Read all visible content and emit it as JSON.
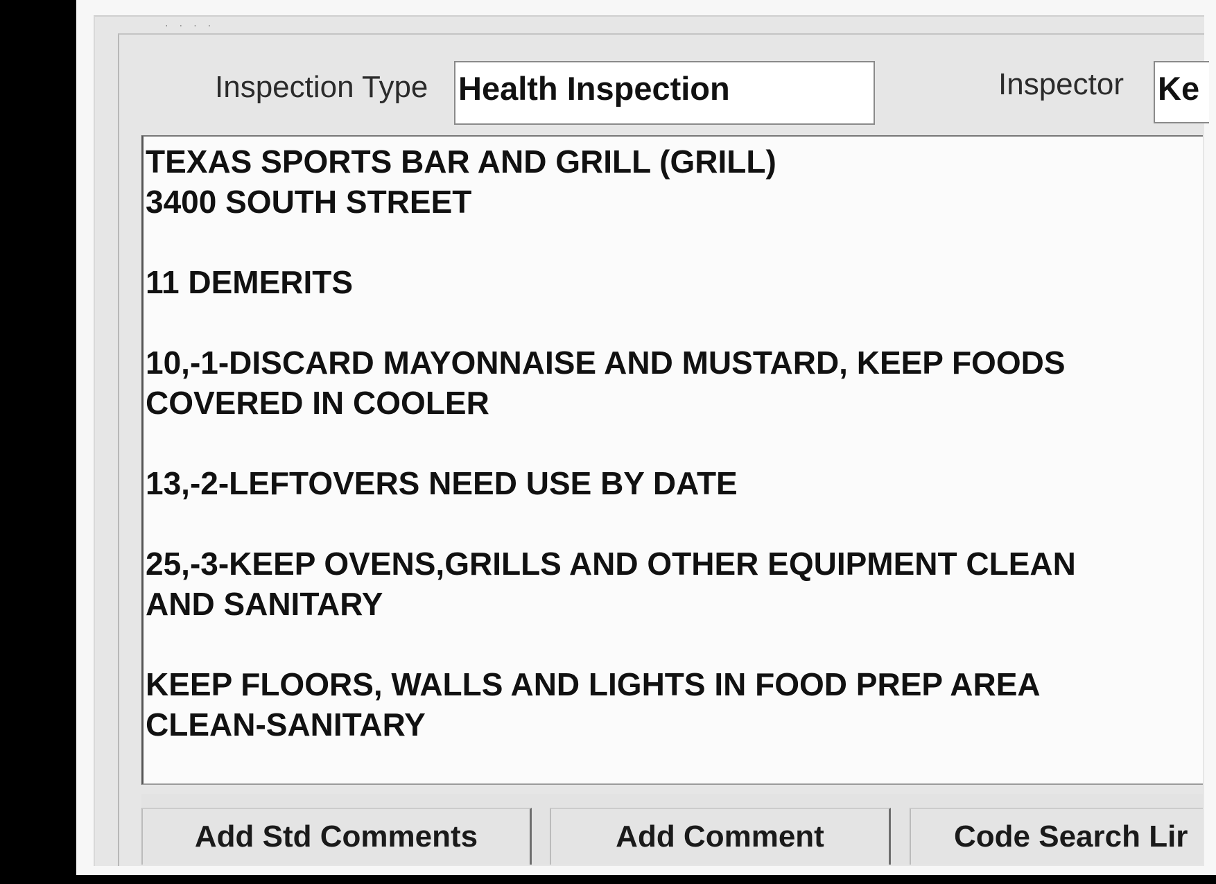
{
  "form": {
    "inspection_type_label": "Inspection Type",
    "inspection_type_value": "Health Inspection",
    "inspector_label": "Inspector",
    "inspector_value": "Ke"
  },
  "comments": {
    "lines": [
      "TEXAS SPORTS BAR AND GRILL (GRILL)",
      "3400 SOUTH STREET",
      "11 DEMERITS",
      "10,-1-DISCARD MAYONNAISE AND MUSTARD, KEEP FOODS",
      "COVERED IN COOLER",
      "13,-2-LEFTOVERS NEED USE BY DATE",
      "25,-3-KEEP OVENS,GRILLS AND OTHER EQUIPMENT CLEAN",
      "AND SANITARY",
      "KEEP FLOORS, WALLS AND LIGHTS IN FOOD PREP AREA",
      "CLEAN-SANITARY"
    ]
  },
  "buttons": {
    "add_std_comments": "Add Std Comments",
    "add_comment": "Add Comment",
    "code_search": "Code Search Lir"
  }
}
